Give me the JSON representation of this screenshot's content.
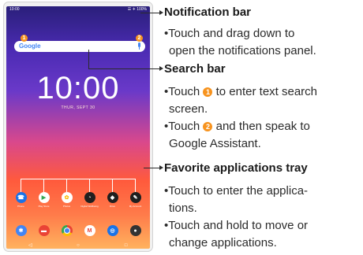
{
  "screen": {
    "status_time": "10:00",
    "status_icons": "☰ ✈ 100%",
    "search_logo": "Google",
    "marker_1": "1",
    "marker_2": "2",
    "clock_time": "10:00",
    "clock_date": "THUR, SEPT 30",
    "favorite_apps": [
      {
        "icon": "phone-icon",
        "label": "Phone",
        "color": "#1a73e8"
      },
      {
        "icon": "play-store-icon",
        "label": "Play Store",
        "color": "#34a853"
      },
      {
        "icon": "photos-icon",
        "label": "Photos",
        "color": "#fbbc04"
      },
      {
        "icon": "digital-wellbeing-icon",
        "label": "Digital Wellbeing",
        "color": "#1f1f1f"
      },
      {
        "icon": "drive-icon",
        "label": "Drive",
        "color": "#1f1f1f"
      },
      {
        "icon": "my-account-icon",
        "label": "My Account",
        "color": "#1f1f1f"
      }
    ],
    "dock_apps": [
      {
        "icon": "settings-icon",
        "color": "#4285f4"
      },
      {
        "icon": "messages-icon",
        "color": "#ea4335"
      },
      {
        "icon": "chrome-icon",
        "color": "#fbbc04"
      },
      {
        "icon": "gmail-icon",
        "color": "#ea4335"
      },
      {
        "icon": "browser-icon",
        "color": "#1a73e8"
      },
      {
        "icon": "camera-icon",
        "color": "#333333"
      }
    ],
    "nav": {
      "back": "◁",
      "home": "○",
      "recents": "□"
    }
  },
  "sections": [
    {
      "title": "Notification bar",
      "text_lines": [
        "•Touch and drag down to",
        "open the notifications panel."
      ]
    },
    {
      "title": "Search bar",
      "items": [
        {
          "before": "•Touch ",
          "marker": "1",
          "after": " to enter text search",
          "cont": "screen."
        },
        {
          "before": "•Touch ",
          "marker": "2",
          "after": " and then speak to",
          "cont": "Google Assistant."
        }
      ]
    },
    {
      "title": "Favorite applications tray",
      "items": [
        {
          "line1": "•Touch to enter the applica-",
          "line2": "tions."
        },
        {
          "line1": "•Touch and hold to move or",
          "line2": "change applications."
        }
      ]
    }
  ],
  "colors": {
    "accent": "#f7931e"
  }
}
